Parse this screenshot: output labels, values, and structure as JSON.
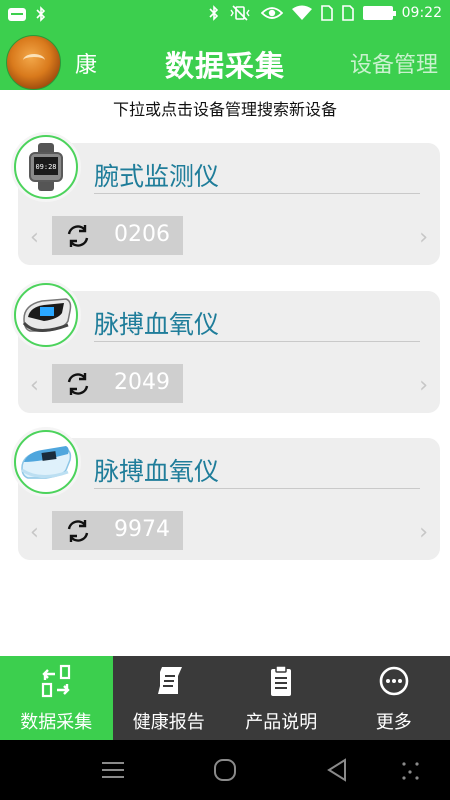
{
  "status_bar": {
    "time": "09:22"
  },
  "header": {
    "user_name": "康",
    "title": "数据采集",
    "device_mgmt": "设备管理"
  },
  "hint": "下拉或点击设备管理搜索新设备",
  "devices": [
    {
      "name": "腕式监测仪",
      "serial": "0206",
      "icon": "wrist-monitor-icon",
      "screen_text": "09:28"
    },
    {
      "name": "脉搏血氧仪",
      "serial": "2049",
      "icon": "pulse-oximeter-icon"
    },
    {
      "name": "脉搏血氧仪",
      "serial": "9974",
      "icon": "pulse-oximeter-blue-icon"
    }
  ],
  "bottom_nav": [
    {
      "label": "数据采集",
      "icon": "data-collect-icon",
      "active": true
    },
    {
      "label": "健康报告",
      "icon": "report-icon",
      "active": false
    },
    {
      "label": "产品说明",
      "icon": "manual-icon",
      "active": false
    },
    {
      "label": "更多",
      "icon": "more-icon",
      "active": false
    }
  ],
  "colors": {
    "accent": "#3ccf4e",
    "nav_bg": "#3a3a3a",
    "device_name": "#1f7d9a",
    "card_bg": "#eeeeee"
  }
}
